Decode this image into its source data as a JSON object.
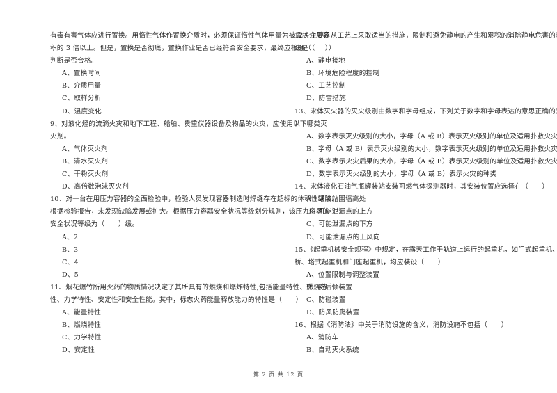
{
  "left_column": [
    {
      "type": "text",
      "text": "有毒有害气体应进行置换。用惰性气体作置换介质时，必须保证惰性气体用量为被置换介质容"
    },
    {
      "type": "text",
      "text": "积的 3 倍以上。但是，置换是否彻底，置换作业是否已经符合安全要求，最终应根据（　　）"
    },
    {
      "type": "text",
      "text": "判断是否合格。"
    },
    {
      "type": "option",
      "text": "A、置换时间"
    },
    {
      "type": "option",
      "text": "B、介质用量"
    },
    {
      "type": "option",
      "text": "C、取样分析"
    },
    {
      "type": "option",
      "text": "D、温度变化"
    },
    {
      "type": "text",
      "text": "9、对液化烃的流淌火灾和地下工程、船舶、贵重仪器设备及物品的火灾，应使用以下哪类灭"
    },
    {
      "type": "text",
      "text": "火剂。"
    },
    {
      "type": "option",
      "text": "A、气体灭火剂"
    },
    {
      "type": "option",
      "text": "B、清水灭火剂"
    },
    {
      "type": "option",
      "text": "C、干粉灭火剂"
    },
    {
      "type": "option",
      "text": "D、高倍数泡沫灭火剂"
    },
    {
      "type": "text",
      "text": "10、对一台在用压力容器的全面检验中，检验人员发现容器制造时焊缝存在超标的体积性缺陷。"
    },
    {
      "type": "text",
      "text": "根据检验报告，未发现缺陷发展或扩大。根据压力容器安全状况等级划分规则，该压力容器的"
    },
    {
      "type": "text",
      "text": "安全状况等级为（　　）级。"
    },
    {
      "type": "option",
      "text": "A、2"
    },
    {
      "type": "option",
      "text": "B、3"
    },
    {
      "type": "option",
      "text": "C、4"
    },
    {
      "type": "option",
      "text": "D、5"
    },
    {
      "type": "text",
      "text": "11、烟花爆竹所用火药的物质情况决定了其所具有的燃烧和爆炸特性,包括能量特性、燃烧特"
    },
    {
      "type": "text",
      "text": "性、力学特性、安定性和安全性能。其中，标志火药能量释放能力的特性是（　　）"
    },
    {
      "type": "option",
      "text": "A、能量特性"
    },
    {
      "type": "option",
      "text": "B、燃烧特性"
    },
    {
      "type": "option",
      "text": "C、力学特性"
    },
    {
      "type": "option",
      "text": "D、安定性"
    }
  ],
  "right_column": [
    {
      "type": "text",
      "text": "12、主要是从工艺上采取适当的措施，限制和避免静电的产生和累积的消除静电危害的重要方"
    },
    {
      "type": "text",
      "text": "法是（　　）"
    },
    {
      "type": "option",
      "text": "A、静电接地"
    },
    {
      "type": "option",
      "text": "B、环境危险程度的控制"
    },
    {
      "type": "option",
      "text": "C、工艺控制"
    },
    {
      "type": "option",
      "text": "D、防雷措施"
    },
    {
      "type": "text",
      "text": "13、宋体灭火器的灭火级别由数字和字母组成，下列关于数字和字母表达的意思正确的是（"
    },
    {
      "type": "text",
      "text": "）"
    },
    {
      "type": "option",
      "text": "A、数字表示灭火级别的大小，字母（A 或 B）表示灭火级别的单位及适用扑救火灾的种类"
    },
    {
      "type": "option",
      "text": "B、字母（A 或 B）表示灭火级别的大小，数字表示灭火级别的单位及适用扑救火灾的种类"
    },
    {
      "type": "option",
      "text": "C、数字表示火灾后果的大小，字母（A 或 B）表示灭火级别的单位及适用扑救火灾的种类"
    },
    {
      "type": "option",
      "text": "D、数字表示灭火级别的大小，字母（A 或 B）表示火灾的种类"
    },
    {
      "type": "text",
      "text": "14、宋体液化石油气瓶罐装站安装可燃气体探测器时，其安装位置应选择在（　　）"
    },
    {
      "type": "option",
      "text": "A、罐装站围墙高处"
    },
    {
      "type": "option",
      "text": "B、可能泄漏点的上方"
    },
    {
      "type": "option",
      "text": "C、可能泄漏点的下方"
    },
    {
      "type": "option",
      "text": "D、可能泄漏点的上风向"
    },
    {
      "type": "text",
      "text": "15、《起重机械安全规程》中规定，在露天工作于轨道上运行的起重机，如门式起重机、装卸"
    },
    {
      "type": "text",
      "text": "桥、塔式起重机和门座起重机，均应装设（　　）"
    },
    {
      "type": "option",
      "text": "A、位置限制与调整装置"
    },
    {
      "type": "option",
      "text": "B、防后倾装置"
    },
    {
      "type": "option",
      "text": "C、防碰装置"
    },
    {
      "type": "option",
      "text": "D、防风防爬装置"
    },
    {
      "type": "text",
      "text": "16、根据《消防法》中关于消防设施的含义，消防设施不包括（　　）"
    },
    {
      "type": "option",
      "text": "A、消防车"
    },
    {
      "type": "option",
      "text": "B、自动灭火系统"
    }
  ],
  "footer": {
    "page_label": "第 2 页 共 12 页"
  }
}
